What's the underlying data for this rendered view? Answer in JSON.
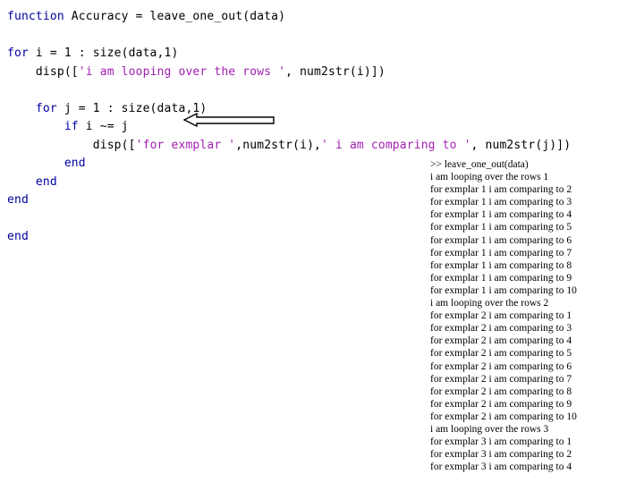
{
  "editor": {
    "name": "matlab-editor",
    "language": "MATLAB",
    "colors": {
      "keyword": "#0000a0",
      "identifier": "#000000",
      "string": "#a020b0",
      "background": "#ffffff"
    },
    "lines": [
      {
        "indent": 0,
        "tokens": [
          {
            "type": "keyword",
            "text": "function"
          },
          {
            "type": "plain",
            "text": " Accuracy = leave_one_out(data)"
          }
        ]
      },
      {
        "indent": 0,
        "tokens": []
      },
      {
        "indent": 0,
        "tokens": [
          {
            "type": "keyword",
            "text": "for"
          },
          {
            "type": "plain",
            "text": " i = 1 : size(data,1)"
          }
        ]
      },
      {
        "indent": 1,
        "tokens": [
          {
            "type": "plain",
            "text": "disp(["
          },
          {
            "type": "string",
            "text": "'i am looping over the rows '"
          },
          {
            "type": "plain",
            "text": ", num2str(i)])"
          }
        ]
      },
      {
        "indent": 0,
        "tokens": []
      },
      {
        "indent": 1,
        "tokens": [
          {
            "type": "keyword",
            "text": "for"
          },
          {
            "type": "plain",
            "text": " j = 1 : size(data,1)"
          }
        ]
      },
      {
        "indent": 2,
        "tokens": [
          {
            "type": "keyword",
            "text": "if"
          },
          {
            "type": "plain",
            "text": " i ~= j"
          }
        ]
      },
      {
        "indent": 3,
        "tokens": [
          {
            "type": "plain",
            "text": "disp(["
          },
          {
            "type": "string",
            "text": "'for exmplar '"
          },
          {
            "type": "plain",
            "text": ",num2str(i),"
          },
          {
            "type": "string",
            "text": "' i am comparing to '"
          },
          {
            "type": "plain",
            "text": ", num2str(j)])"
          }
        ]
      },
      {
        "indent": 2,
        "tokens": [
          {
            "type": "keyword",
            "text": "end"
          }
        ]
      },
      {
        "indent": 1,
        "tokens": [
          {
            "type": "keyword",
            "text": "end"
          }
        ]
      },
      {
        "indent": 0,
        "tokens": [
          {
            "type": "keyword",
            "text": "end"
          }
        ]
      },
      {
        "indent": 0,
        "tokens": []
      },
      {
        "indent": 0,
        "tokens": [
          {
            "type": "keyword",
            "text": "end"
          }
        ]
      }
    ]
  },
  "annotation": {
    "arrow_icon": "left-arrow-icon",
    "points_to_line": "if i ~= j",
    "color": "#000000",
    "fill": "#ffffff"
  },
  "console": {
    "name": "matlab-command-window",
    "prompt": ">>",
    "command": "leave_one_out(data)",
    "lines": [
      ">> leave_one_out(data)",
      "i am looping over the rows 1",
      "for exmplar 1 i am comparing to 2",
      "for exmplar 1 i am comparing to 3",
      "for exmplar 1 i am comparing to 4",
      "for exmplar 1 i am comparing to 5",
      "for exmplar 1 i am comparing to 6",
      "for exmplar 1 i am comparing to 7",
      "for exmplar 1 i am comparing to 8",
      "for exmplar 1 i am comparing to 9",
      "for exmplar 1 i am comparing to 10",
      "i am looping over the rows 2",
      "for exmplar 2 i am comparing to 1",
      "for exmplar 2 i am comparing to 3",
      "for exmplar 2 i am comparing to 4",
      "for exmplar 2 i am comparing to 5",
      "for exmplar 2 i am comparing to 6",
      "for exmplar 2 i am comparing to 7",
      "for exmplar 2 i am comparing to 8",
      "for exmplar 2 i am comparing to 9",
      "for exmplar 2 i am comparing to 10",
      "i am looping over the rows 3",
      "for exmplar 3 i am comparing to 1",
      "for exmplar 3 i am comparing to 2",
      "for exmplar 3 i am comparing to 4"
    ]
  }
}
